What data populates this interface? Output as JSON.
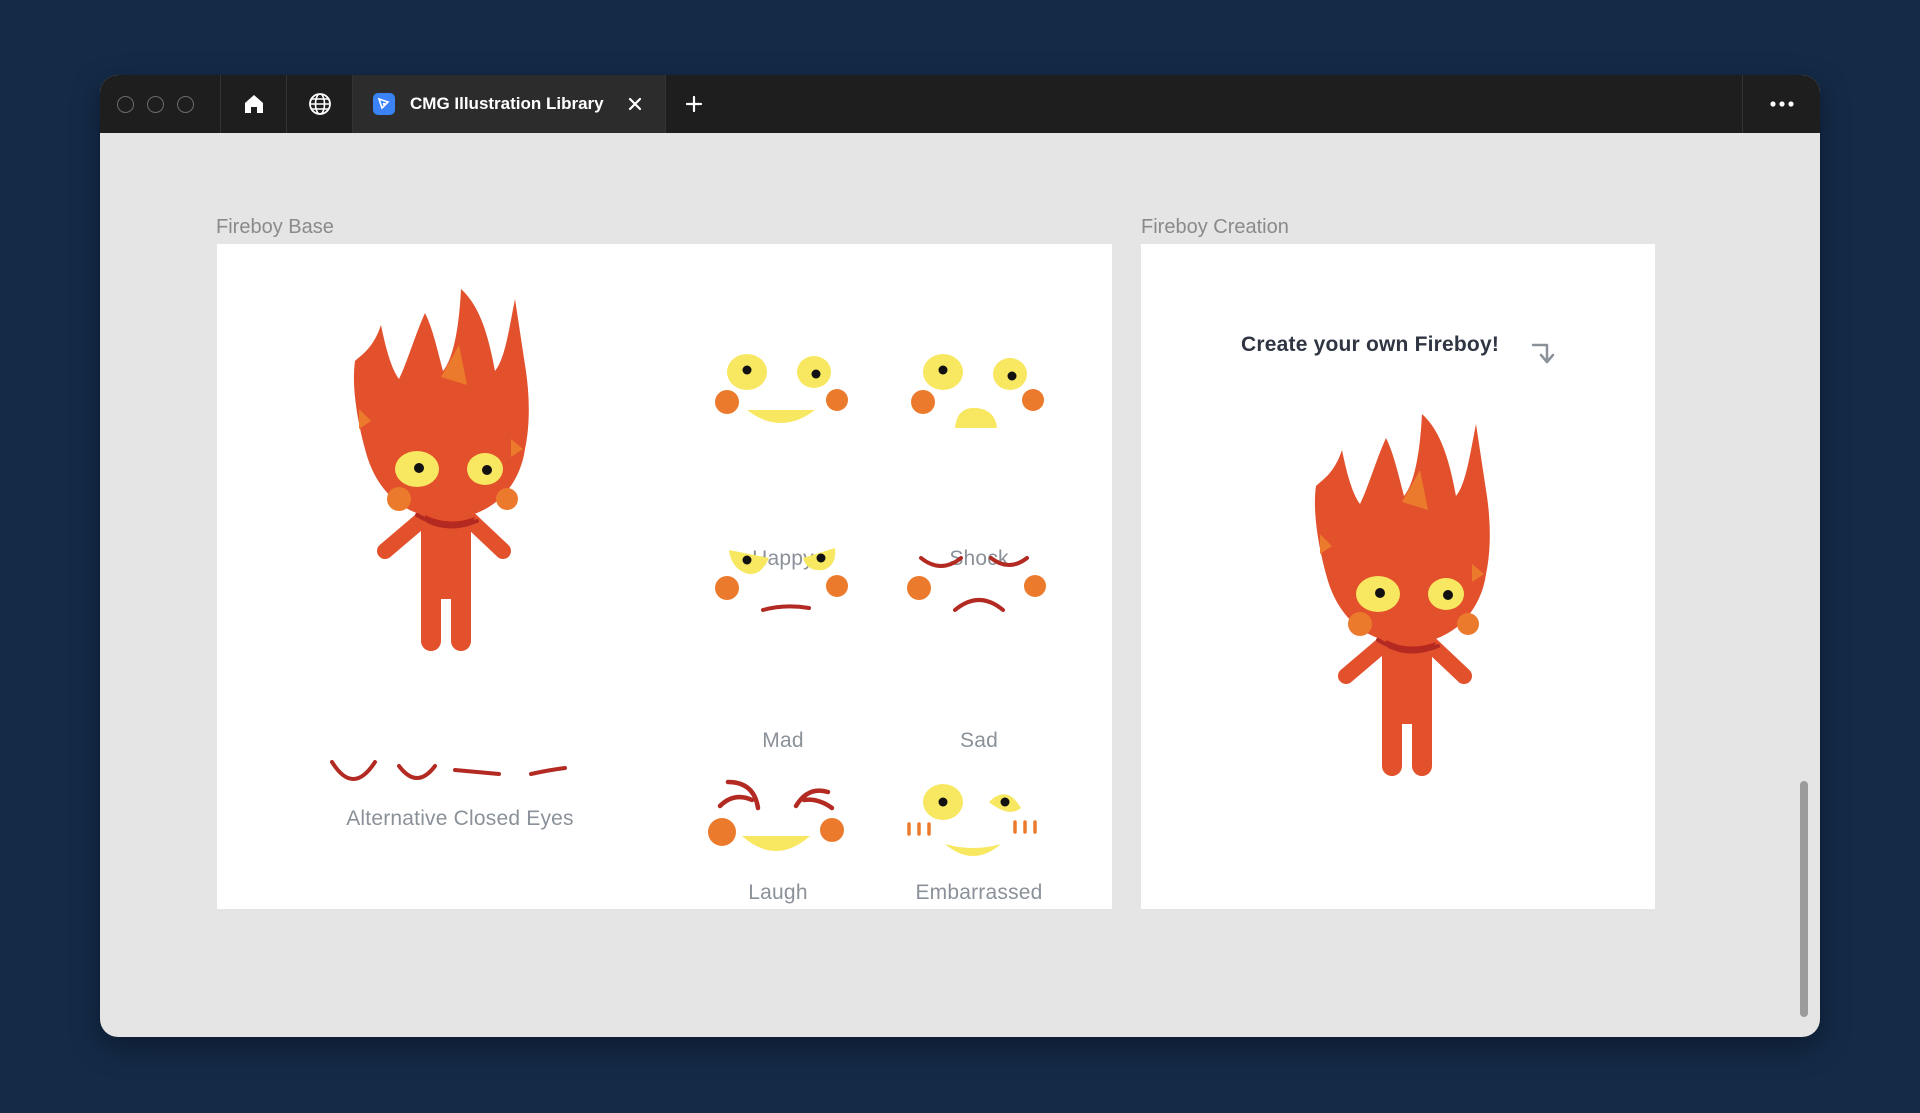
{
  "browser": {
    "tab_title": "CMG Illustration Library",
    "icons": [
      "home-icon",
      "globe-icon",
      "close-icon",
      "plus-icon",
      "more-icon"
    ]
  },
  "canvas": {
    "frames": [
      {
        "label": "Fireboy Base",
        "expressions": [
          "Happy",
          "Shock",
          "Mad",
          "Sad",
          "Laugh",
          "Embarrassed"
        ],
        "closed_eyes_caption": "Alternative Closed Eyes"
      },
      {
        "label": "Fireboy Creation",
        "cta": "Create your own Fireboy!"
      }
    ]
  },
  "colors": {
    "background": "#142a47",
    "flame": "#e2502c",
    "flame_dark": "#ec7a2c",
    "eye": "#f8e861",
    "cheek": "#ec7a2c",
    "line": "#b22a22"
  }
}
